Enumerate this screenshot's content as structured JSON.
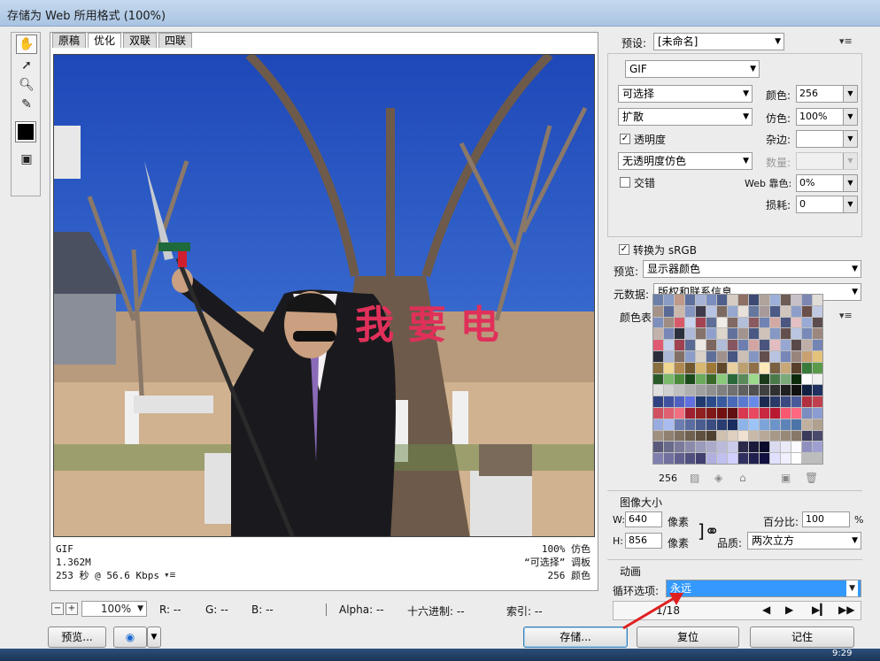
{
  "window": {
    "title": "存储为 Web 所用格式 (100%)"
  },
  "tools": [
    "hand-icon",
    "slice-select-icon",
    "zoom-icon",
    "eyedropper-icon"
  ],
  "view_tabs": [
    "原稿",
    "优化",
    "双联",
    "四联"
  ],
  "image_overlay_text": "我 要 电",
  "info": {
    "format": "GIF",
    "size": "1.362M",
    "time": "253 秒 @ 56.6 Kbps",
    "dither": "100% 仿色",
    "palette": "“可选择” 调板",
    "colors": "256 颜色"
  },
  "statusbar": {
    "zoom": "100%",
    "r": "R: --",
    "g": "G: --",
    "b": "B: --",
    "alpha": "Alpha: --",
    "hex": "十六进制: --",
    "index": "索引: --"
  },
  "settings": {
    "preset_label": "预设:",
    "preset_value": "[未命名]",
    "format": "GIF",
    "reduction": "可选择",
    "colors_label": "颜色:",
    "colors_value": "256",
    "dither_algo": "扩散",
    "dither_label": "仿色:",
    "dither_value": "100%",
    "transparency_label": "透明度",
    "matte_label": "杂边:",
    "transparency_dither": "无透明度仿色",
    "amount_label": "数量:",
    "interlaced_label": "交错",
    "web_snap_label": "Web 靠色:",
    "web_snap_value": "0%",
    "lossy_label": "损耗:",
    "lossy_value": "0",
    "convert_srgb_label": "转换为 sRGB",
    "preview_label": "预览:",
    "preview_value": "显示器颜色",
    "metadata_label": "元数据:",
    "metadata_value": "版权和联系信息"
  },
  "color_table": {
    "title": "颜色表",
    "count": "256",
    "colors": [
      "#6b7fa8",
      "#8a9bc4",
      "#c09a88",
      "#5d6f9c",
      "#a7b3d6",
      "#7a8fbf",
      "#4f5f8c",
      "#d6ccc3",
      "#8e6f63",
      "#3c4a73",
      "#b0a39b",
      "#9cb0d9",
      "#6d5b55",
      "#c8c0c9",
      "#7b86b3",
      "#e0dcd8",
      "#a49289",
      "#5a6a96",
      "#cbb8ac",
      "#8594c1",
      "#3f3a4c",
      "#b7c3e3",
      "#7c6a62",
      "#97a7d0",
      "#e8e0da",
      "#65769f",
      "#a89a9a",
      "#4b5a86",
      "#d0c6be",
      "#8d9ec9",
      "#6a4f4b",
      "#bfc8e2",
      "#7e8fbd",
      "#9f8c83",
      "#d85a6a",
      "#c8d4ee",
      "#a44452",
      "#5e6e98",
      "#f2ece6",
      "#816a63",
      "#b4bfd9",
      "#8a5a60",
      "#6f82b2",
      "#d3a9a6",
      "#4c5680",
      "#e4c0c4",
      "#9aaad4",
      "#5d4c4d",
      "#c2b2ab",
      "#7687b6",
      "#2c2f3d",
      "#aeb9d8",
      "#84726b",
      "#90a0cc",
      "#ddd4cc",
      "#61719b",
      "#a2938f",
      "#4a5884",
      "#cfc2b8",
      "#8697c4",
      "#64504e",
      "#bac5e2",
      "#7989b9",
      "#9c877e",
      "#e05a72",
      "#c4cfeb",
      "#a04150",
      "#5b6a94",
      "#efe8e2",
      "#7d665f",
      "#b1bcd8",
      "#875761",
      "#6c7fb0",
      "#d2a5a4",
      "#4a547d",
      "#e2bcc0",
      "#97a7d1",
      "#5a4949",
      "#bfaea7",
      "#7484b3",
      "#2a2d3a",
      "#acb7d6",
      "#816f68",
      "#8d9dc9",
      "#dad1c9",
      "#5f6f99",
      "#a0918c",
      "#485682",
      "#ccbfb5",
      "#8495c2",
      "#624e4c",
      "#b8c3e0",
      "#7787b7",
      "#99857c",
      "#c9a070",
      "#e3c27a",
      "#8a7040",
      "#f0d890",
      "#b08850",
      "#705830",
      "#d8b870",
      "#a07838",
      "#60482a",
      "#e8d0a0",
      "#bca070",
      "#907048",
      "#fce8b8",
      "#786040",
      "#c8a878",
      "#58402a",
      "#3a7a3a",
      "#5a9a4a",
      "#2a5a2a",
      "#7aba6a",
      "#4a8a3a",
      "#1a4a1a",
      "#6aaa5a",
      "#3a6a2a",
      "#8aca7a",
      "#2a6a3a",
      "#5a8a5a",
      "#9ada8a",
      "#1a3a1a",
      "#4a7a4a",
      "#7aaa7a",
      "#0a2a0a",
      "#ffffff",
      "#f0f0f0",
      "#e0e0e0",
      "#d0d0d0",
      "#c0c0c0",
      "#b0b0b0",
      "#a0a0a0",
      "#909090",
      "#808080",
      "#707070",
      "#606060",
      "#505050",
      "#404040",
      "#303030",
      "#202020",
      "#101010",
      "#102040",
      "#203060",
      "#304080",
      "#4050a0",
      "#5060c0",
      "#6070e0",
      "#203a70",
      "#2a4a8a",
      "#3a5aa0",
      "#4a6ab8",
      "#5a7ad0",
      "#6a8ae8",
      "#1a2a50",
      "#2a3a68",
      "#3a4a80",
      "#4a5a98",
      "#b03040",
      "#c04050",
      "#d05060",
      "#e06070",
      "#f07080",
      "#a02030",
      "#902020",
      "#801818",
      "#701010",
      "#601010",
      "#d83850",
      "#e84860",
      "#c82840",
      "#b81830",
      "#f85870",
      "#ff6880",
      "#7a8cc0",
      "#8a9cd0",
      "#9aacdf",
      "#aabcef",
      "#6a7cb0",
      "#5a6ca0",
      "#4a5c90",
      "#3a4c80",
      "#2a3c70",
      "#1a2c60",
      "#8cb4e8",
      "#9cc4f8",
      "#7ca4d8",
      "#6c94c8",
      "#5c84b8",
      "#4c74a8",
      "#c0b0a0",
      "#b0a090",
      "#a09080",
      "#908070",
      "#807060",
      "#706050",
      "#605040",
      "#504030",
      "#d0c0b0",
      "#e0d0c0",
      "#f0e0d0",
      "#c8b8a8",
      "#b8a898",
      "#a89888",
      "#988878",
      "#887868",
      "#3a3a5a",
      "#4a4a6a",
      "#5a5a7a",
      "#6a6a8a",
      "#7a7a9a",
      "#8a8aaa",
      "#9a9aba",
      "#aaaaca",
      "#babada",
      "#cacaea",
      "#2a2a4a",
      "#1a1a3a",
      "#0a0a2a",
      "#dadaf0",
      "#eaeaf8",
      "#fafaff",
      "#9090c0",
      "#a0a0d0",
      "#8080b0",
      "#7070a0",
      "#606090",
      "#505080",
      "#404070",
      "#b0b0e0",
      "#c0c0f0",
      "#d0d0ff",
      "#303060",
      "#202050",
      "#101040",
      "#e0e0ff",
      "#f0f0ff",
      "#ffffff"
    ]
  },
  "image_size": {
    "title": "图像大小",
    "w_label": "W:",
    "w_value": "640",
    "h_label": "H:",
    "h_value": "856",
    "unit": "像素",
    "percent_label": "百分比:",
    "percent_value": "100",
    "percent_unit": "%",
    "quality_label": "品质:",
    "quality_value": "两次立方"
  },
  "animation": {
    "title": "动画",
    "loop_label": "循环选项:",
    "loop_value": "永远",
    "frame_text": "1/18"
  },
  "buttons": {
    "preview": "预览...",
    "save": "存储...",
    "reset": "复位",
    "remember": "记住"
  },
  "taskbar": {
    "clock": "9:29"
  }
}
